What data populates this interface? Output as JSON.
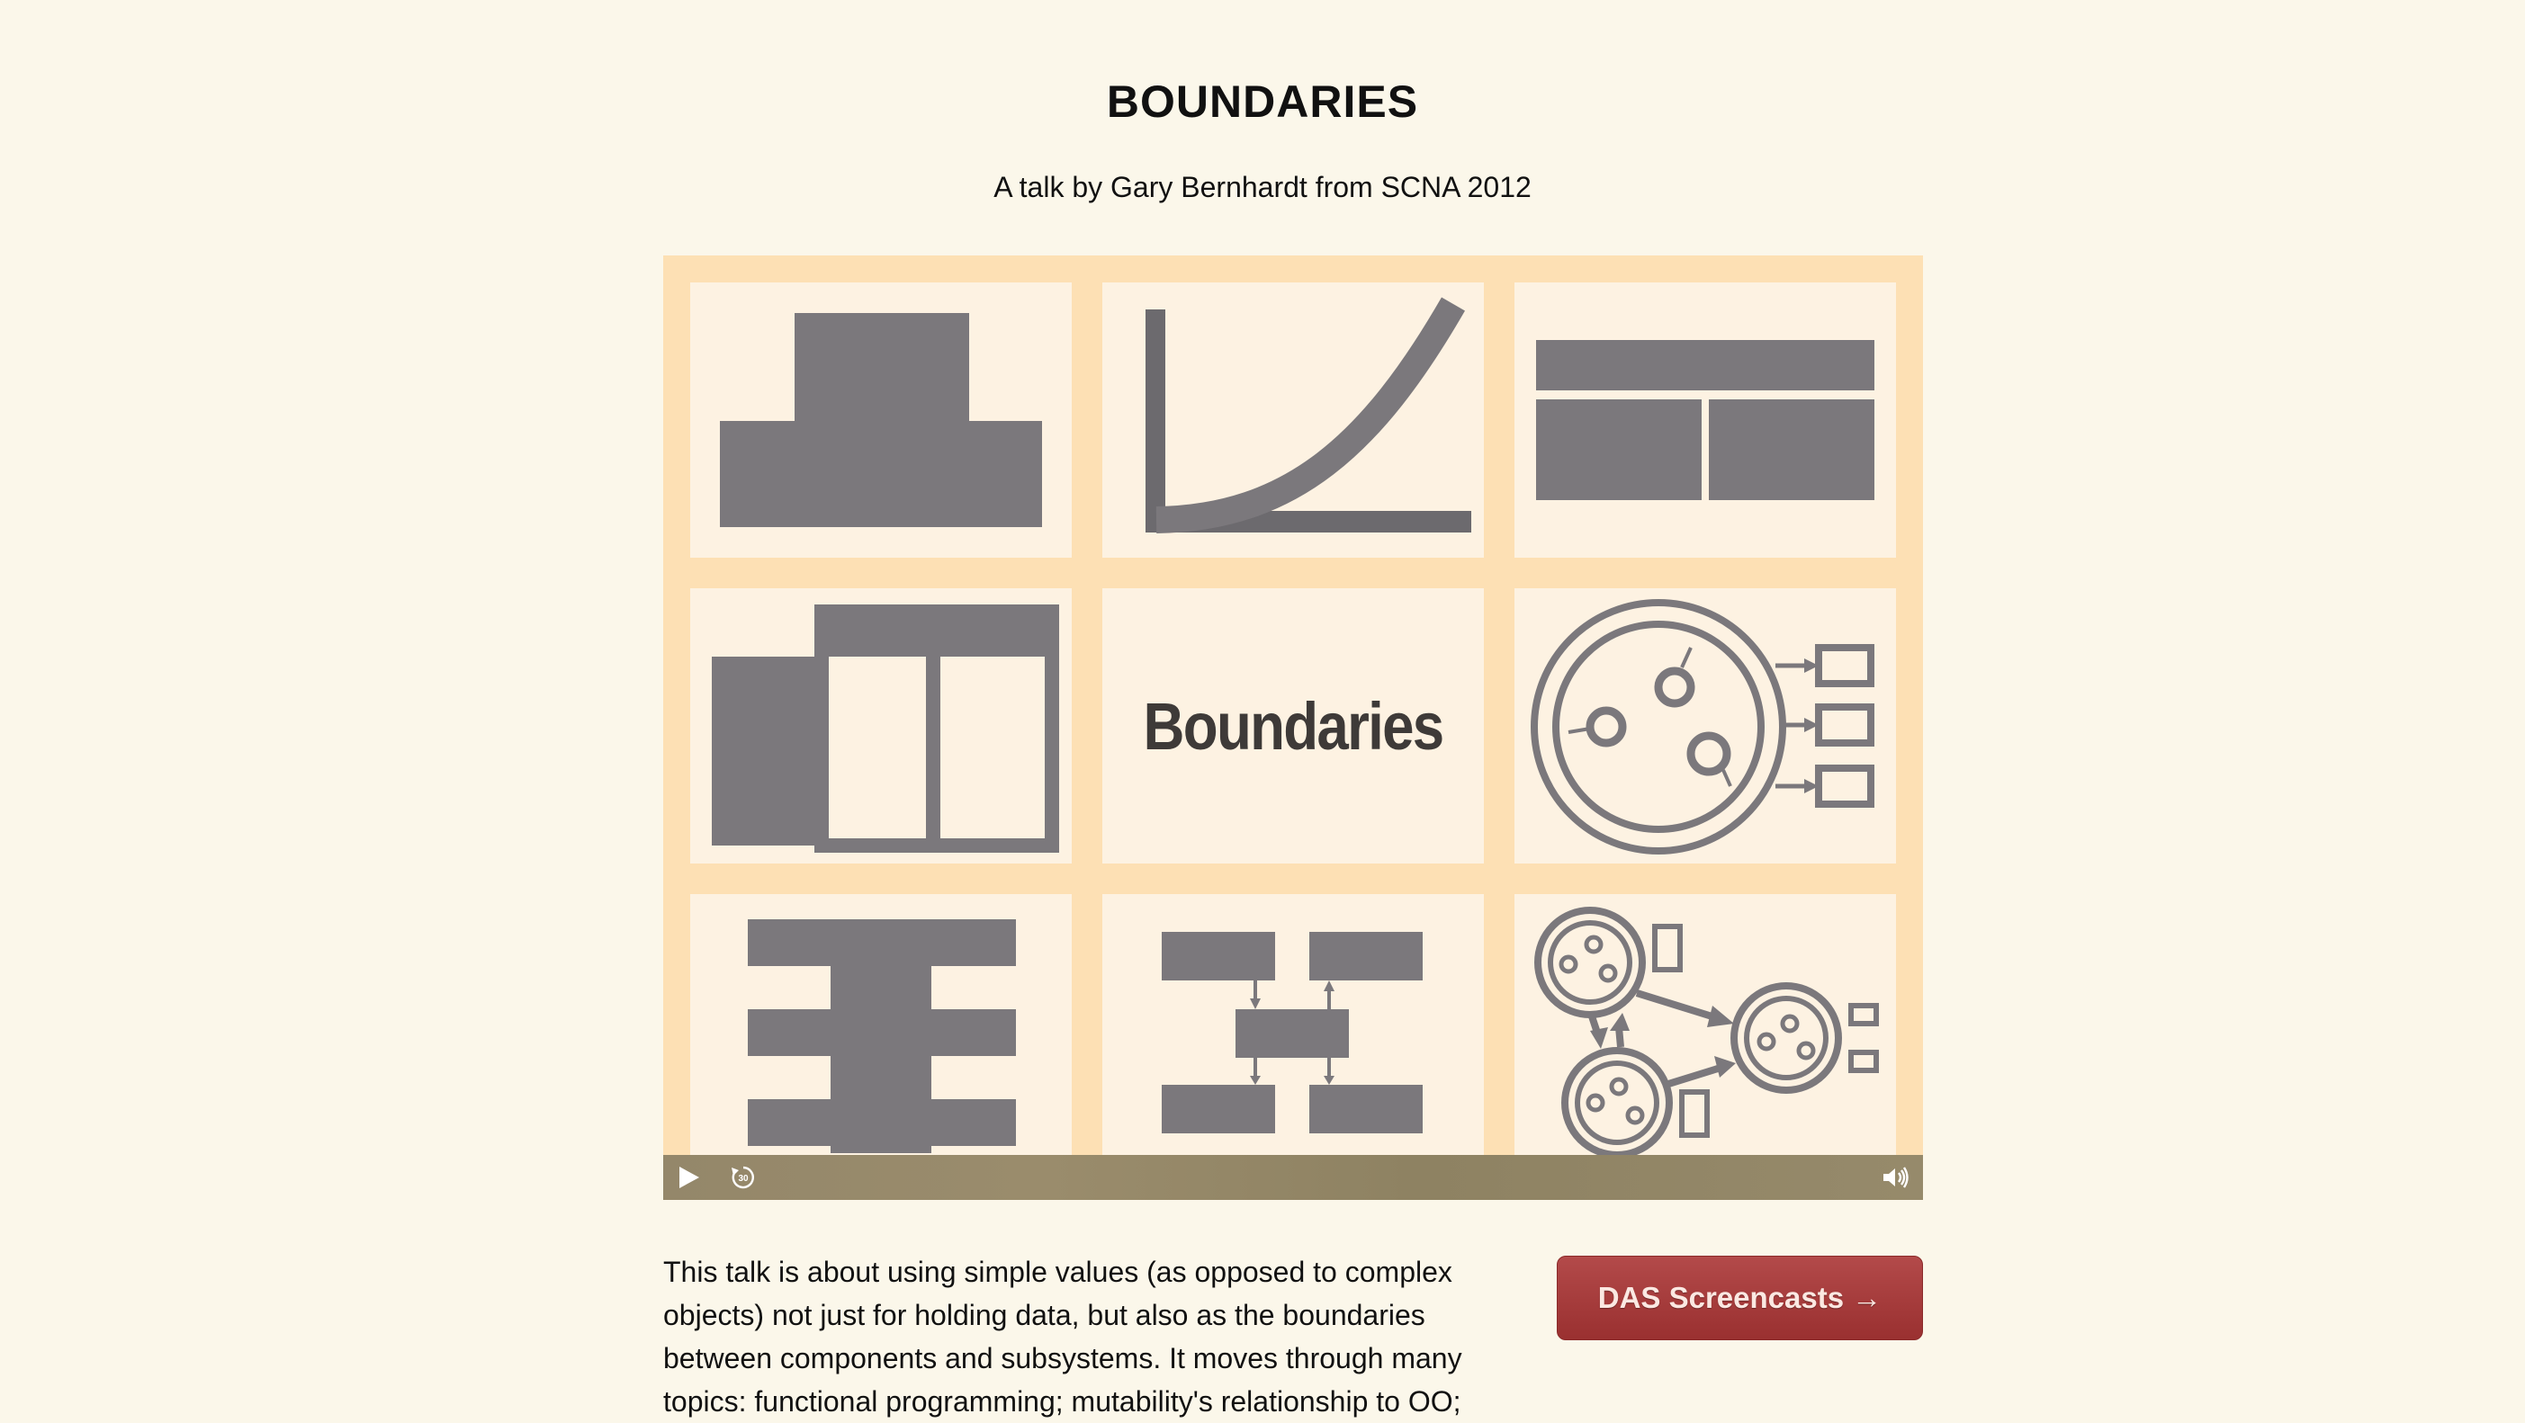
{
  "header": {
    "title": "BOUNDARIES",
    "subtitle": "A talk by Gary Bernhardt from SCNA 2012"
  },
  "video": {
    "poster_title": "Boundaries",
    "controls": {
      "play_icon": "play-icon",
      "rewind_icon": "rewind-30-icon",
      "rewind_label": "30",
      "volume_icon": "volume-icon"
    },
    "colors": {
      "frame": "#fde0b4",
      "tile": "#fdf2e2",
      "shape": "#7b787c",
      "control_bar": "#94876a"
    }
  },
  "description": {
    "text": "This talk is about using simple values (as opposed to complex objects) not just for holding data, but also as the boundaries between components and subsystems. It moves through many topics: functional programming; mutability's relationship to OO;"
  },
  "cta": {
    "label": "DAS Screencasts →",
    "color": "#a33a3a"
  }
}
